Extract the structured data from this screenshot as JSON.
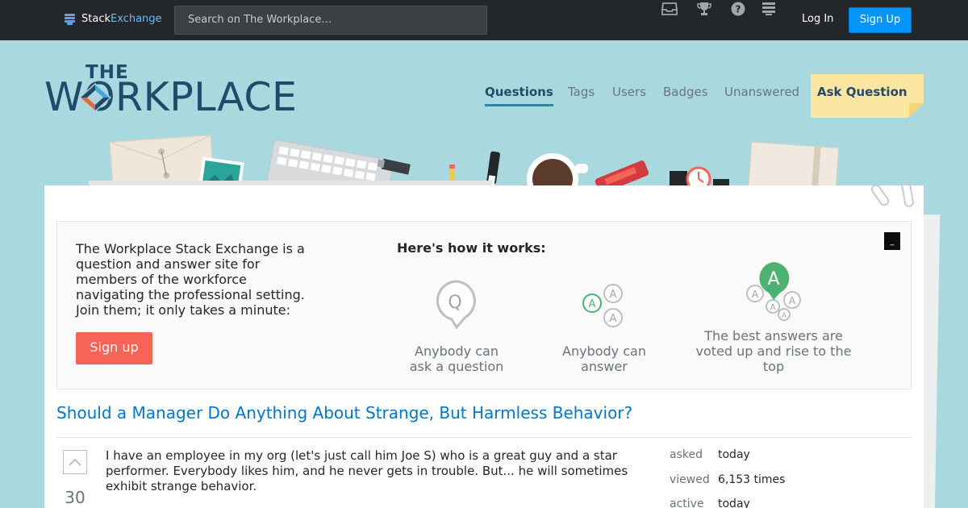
{
  "topbar": {
    "logo_stack": "Stack",
    "logo_exchange": "Exchange",
    "search_placeholder": "Search on The Workplace…",
    "icons": [
      "inbox-icon",
      "trophy-icon",
      "help-icon",
      "site-switcher-icon"
    ],
    "login_label": "Log In",
    "signup_label": "Sign Up"
  },
  "header": {
    "logo_small": "THE",
    "logo_main": "WORKPLACE",
    "nav": [
      {
        "label": "Questions",
        "active": true
      },
      {
        "label": "Tags",
        "active": false
      },
      {
        "label": "Users",
        "active": false
      },
      {
        "label": "Badges",
        "active": false
      },
      {
        "label": "Unanswered",
        "active": false
      }
    ],
    "ask_label": "Ask Question"
  },
  "intro": {
    "text": "The Workplace Stack Exchange is a question and answer site for members of the workforce navigating the professional setting. Join them; it only takes a minute:",
    "signup_label": "Sign up",
    "how_title": "Here's how it works:",
    "steps": [
      {
        "icon": "question-bubble-icon",
        "label": "Anybody can ask a question",
        "glyph": "Q"
      },
      {
        "icon": "answers-bubbles-icon",
        "label": "Anybody can answer",
        "glyph": "A"
      },
      {
        "icon": "top-answer-icon",
        "label": "The best answers are voted up and rise to the top",
        "glyph": "A"
      }
    ],
    "close_glyph": "_"
  },
  "question": {
    "title": "Should a Manager Do Anything About Strange, But Harmless Behavior?",
    "votes": "30",
    "body": "I have an employee in my org (let's just call him Joe S) who is a great guy and a star performer. Everybody likes him, and he never gets in trouble. But... he will sometimes exhibit strange behavior.",
    "meta": [
      {
        "label": "asked",
        "value": "today"
      },
      {
        "label": "viewed",
        "value": "6,153 times"
      },
      {
        "label": "active",
        "value": "today"
      }
    ]
  },
  "colors": {
    "topbar": "#242729",
    "background": "#a9d9de",
    "primary_blue": "#0095ff",
    "link_blue": "#0077cc",
    "signup_red": "#f56456",
    "brand_navy": "#234a6b",
    "brand_orange": "#e8673c",
    "answer_green": "#4cb272"
  }
}
